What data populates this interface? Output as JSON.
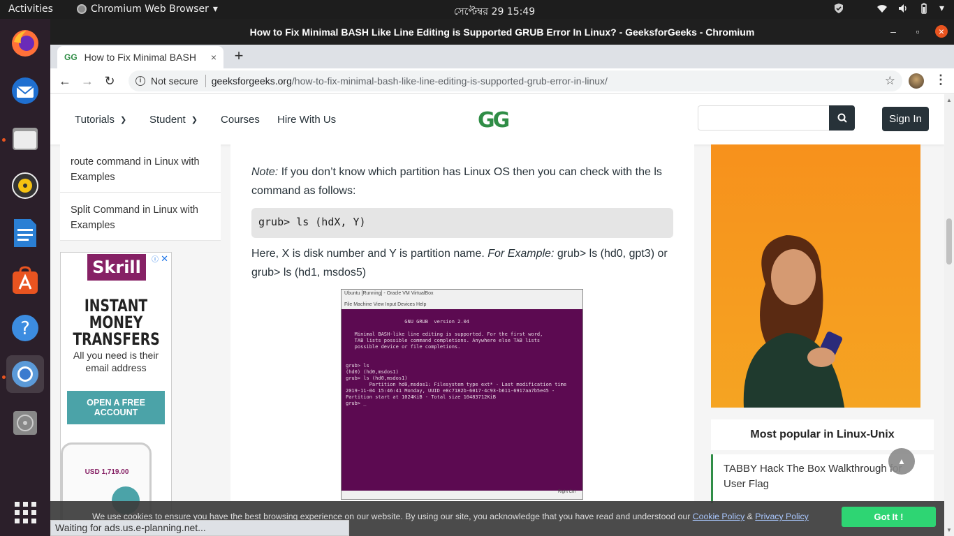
{
  "topbar": {
    "activities": "Activities",
    "app_name": "Chromium Web Browser",
    "clock": "সেপ্টেম্বর 29  15:49"
  },
  "window": {
    "title": "How to Fix Minimal BASH Like Line Editing is Supported GRUB Error In Linux? - GeeksforGeeks - Chromium"
  },
  "tab": {
    "favicon_text": "GG",
    "label": "How to Fix Minimal BASH",
    "close": "×"
  },
  "toolbar": {
    "security_label": "Not secure",
    "url_host": "geeksforgeeks.org",
    "url_path": "/how-to-fix-minimal-bash-like-line-editing-is-supported-grub-error-in-linux/"
  },
  "site_header": {
    "nav": [
      "Tutorials",
      "Student",
      "Courses",
      "Hire With Us"
    ],
    "logo": "GG",
    "signin": "Sign In"
  },
  "left_sidebar": {
    "links": [
      "route command in Linux with Examples",
      "Split Command in Linux with Examples"
    ]
  },
  "left_ad": {
    "brand": "Skrill",
    "headline": "INSTANT MONEY TRANSFERS",
    "sub": "All you need is their email address",
    "cta": "OPEN A FREE ACCOUNT",
    "phone_balance": "USD 1,719.00"
  },
  "article": {
    "note_label": "Note:",
    "note_text": " If you don’t know which partition has Linux OS then you can check with the ls command as follows:",
    "code": "grub> ls (hdX, Y)",
    "para2_a": "Here, X is disk number and Y is partition name. ",
    "para2_em": "For Example:",
    "para2_b": " grub> ls (hd0, gpt3) or grub> ls (hd1, msdos5)"
  },
  "vbox": {
    "title": "Ubuntu [Running] - Oracle VM VirtualBox",
    "menu": "File   Machine   View   Input   Devices   Help",
    "screen": "                    GNU GRUB  version 2.04\n\n   Minimal BASH-like line editing is supported. For the first word,\n   TAB lists possible command completions. Anywhere else TAB lists\n   possible device or file completions.\n\n\ngrub> ls\n(hd0) (hd0,msdos1)\ngrub> ls (hd0,msdos1)\n        Partition hd0,msdos1: Filesystem type ext* - Last modification time\n2019-11-04 15:46:41 Monday, UUID e8c7182b-6017-4c93-b611-6917aa7b5e45 -\nPartition start at 1024KiB - Total size 10483712KiB\ngrub> _",
    "status": "Right Ctrl"
  },
  "right_column": {
    "popular_title": "Most popular in Linux-Unix",
    "popular_item": "TABBY Hack The Box Walkthrough for User Flag"
  },
  "cookie": {
    "text": "We use cookies to ensure you have the best browsing experience on our website. By using our site, you acknowledge that you have read and understood our ",
    "policy": "Cookie Policy",
    "amp": " & ",
    "privacy": "Privacy Policy",
    "button": "Got It !"
  },
  "status_bar": "Waiting for ads.us.e-planning.net..."
}
